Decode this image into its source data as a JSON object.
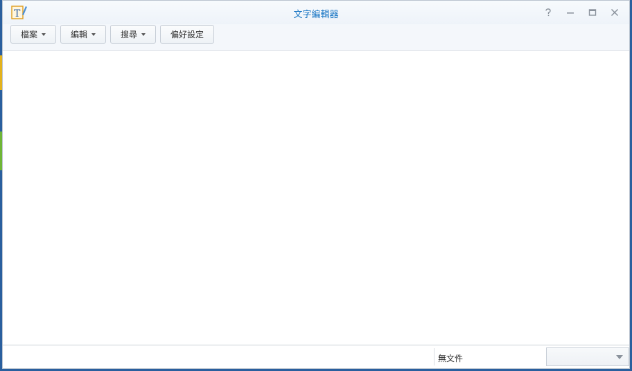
{
  "window": {
    "title": "文字編輯器",
    "app_icon": "text-editor-icon",
    "controls": [
      {
        "name": "help",
        "icon": "help-icon"
      },
      {
        "name": "minimize",
        "icon": "minimize-icon"
      },
      {
        "name": "maximize",
        "icon": "maximize-icon"
      },
      {
        "name": "close",
        "icon": "close-icon"
      }
    ],
    "title_color": "#1976c4"
  },
  "toolbar": {
    "file_label": "檔案",
    "edit_label": "編輯",
    "search_label": "搜尋",
    "preferences_label": "偏好設定"
  },
  "editor": {
    "content": ""
  },
  "statusbar": {
    "document_status": "無文件",
    "encoding_value": ""
  }
}
